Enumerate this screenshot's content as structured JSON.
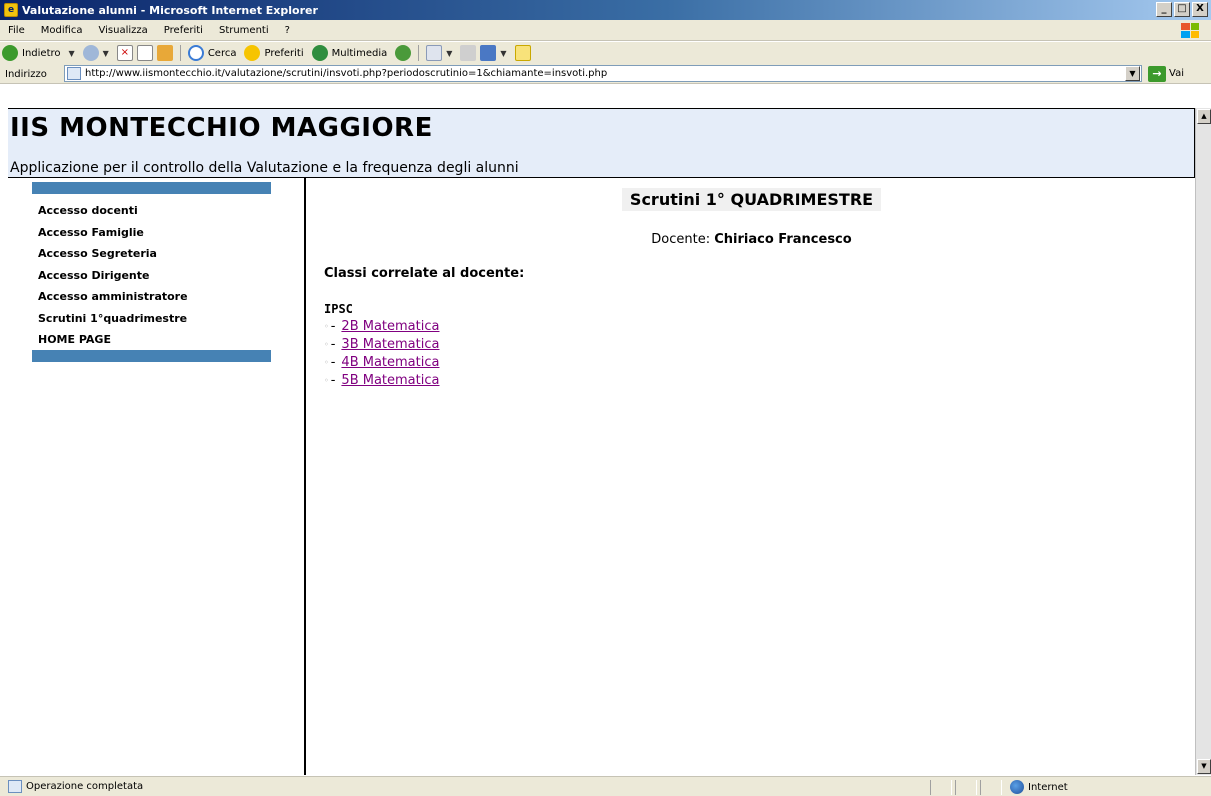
{
  "window": {
    "title": "Valutazione alunni - Microsoft Internet Explorer",
    "controls": [
      "_",
      "□",
      "X"
    ]
  },
  "menu": [
    "File",
    "Modifica",
    "Visualizza",
    "Preferiti",
    "Strumenti",
    "?"
  ],
  "toolbar": {
    "back_label": "Indietro",
    "search_label": "Cerca",
    "favorites_label": "Preferiti",
    "media_label": "Multimedia"
  },
  "address": {
    "label": "Indirizzo",
    "url": "http://www.iismontecchio.it/valutazione/scrutini/insvoti.php?periodoscrutinio=1&chiamante=insvoti.php",
    "go_label": "Vai"
  },
  "page": {
    "site_title": "IIS MONTECCHIO MAGGIORE",
    "site_subtitle": "Applicazione per il controllo della Valutazione e la frequenza degli alunni",
    "nav": [
      "Accesso docenti",
      "Accesso Famiglie",
      "Accesso Segreteria",
      "Accesso Dirigente",
      "Accesso amministratore",
      "Scrutini 1°quadrimestre",
      "HOME PAGE"
    ],
    "main_title": "Scrutini 1° QUADRIMESTRE",
    "docente_label": "Docente:",
    "docente_name": "Chiriaco Francesco",
    "classi_heading": "Classi correlate al docente:",
    "school_code": "IPSC",
    "classes": [
      "2B Matematica",
      "3B Matematica",
      "4B Matematica",
      "5B Matematica"
    ]
  },
  "status": {
    "text": "Operazione completata",
    "zone": "Internet"
  },
  "colors": {
    "titlebar": "#0a246a",
    "header_bg": "#e5edf9",
    "nav_strip": "#4682b4",
    "link_visited": "#800080"
  }
}
